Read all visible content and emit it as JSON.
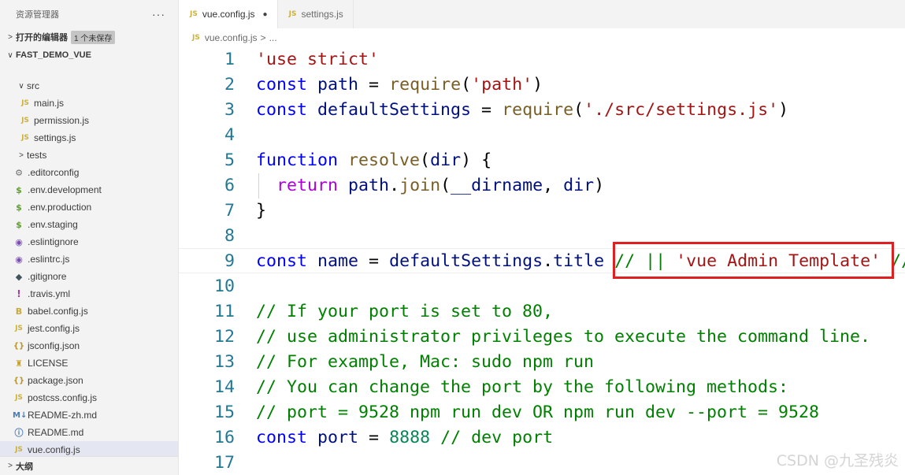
{
  "explorer": {
    "title": "资源管理器",
    "more": "···",
    "open_editors": {
      "label": "打开的编辑器",
      "badge": "1 个未保存"
    },
    "project": {
      "label": "FAST_DEMO_VUE"
    },
    "tree": [
      {
        "name": "src",
        "indent": 1,
        "type": "folder",
        "chev": "∨"
      },
      {
        "name": "main.js",
        "indent": 2,
        "icon": "JS"
      },
      {
        "name": "permission.js",
        "indent": 2,
        "icon": "JS"
      },
      {
        "name": "settings.js",
        "indent": 2,
        "icon": "JS"
      },
      {
        "name": "tests",
        "indent": 1,
        "type": "folder",
        "chev": ">"
      },
      {
        "name": ".editorconfig",
        "indent": 1,
        "icon": "⚙"
      },
      {
        "name": ".env.development",
        "indent": 1,
        "icon": "$"
      },
      {
        "name": ".env.production",
        "indent": 1,
        "icon": "$"
      },
      {
        "name": ".env.staging",
        "indent": 1,
        "icon": "$"
      },
      {
        "name": ".eslintignore",
        "indent": 1,
        "icon": "◉"
      },
      {
        "name": ".eslintrc.js",
        "indent": 1,
        "icon": "◉"
      },
      {
        "name": ".gitignore",
        "indent": 1,
        "icon": "◆"
      },
      {
        "name": ".travis.yml",
        "indent": 1,
        "icon": "!"
      },
      {
        "name": "babel.config.js",
        "indent": 1,
        "icon": "B"
      },
      {
        "name": "jest.config.js",
        "indent": 1,
        "icon": "JS"
      },
      {
        "name": "jsconfig.json",
        "indent": 1,
        "icon": "{}"
      },
      {
        "name": "LICENSE",
        "indent": 1,
        "icon": "♜"
      },
      {
        "name": "package.json",
        "indent": 1,
        "icon": "{}"
      },
      {
        "name": "postcss.config.js",
        "indent": 1,
        "icon": "JS"
      },
      {
        "name": "README-zh.md",
        "indent": 1,
        "icon": "M↓"
      },
      {
        "name": "README.md",
        "indent": 1,
        "icon": "ⓘ"
      },
      {
        "name": "vue.config.js",
        "indent": 1,
        "icon": "JS",
        "selected": true
      }
    ],
    "outline": {
      "label": "大纲"
    }
  },
  "tabs": [
    {
      "label": "vue.config.js",
      "icon": "JS",
      "active": true,
      "dirty": "●"
    },
    {
      "label": "settings.js",
      "icon": "JS",
      "active": false
    }
  ],
  "breadcrumb": {
    "icon": "JS",
    "file": "vue.config.js",
    "sep": ">",
    "rest": "..."
  },
  "editor": {
    "lines": [
      {
        "n": "1",
        "tokens": [
          [
            "str",
            "'use strict'"
          ]
        ]
      },
      {
        "n": "2",
        "tokens": [
          [
            "kw",
            "const"
          ],
          [
            "plain",
            " "
          ],
          [
            "var",
            "path"
          ],
          [
            "plain",
            " = "
          ],
          [
            "fn",
            "require"
          ],
          [
            "plain",
            "("
          ],
          [
            "str",
            "'path'"
          ],
          [
            "plain",
            ")"
          ]
        ]
      },
      {
        "n": "3",
        "tokens": [
          [
            "kw",
            "const"
          ],
          [
            "plain",
            " "
          ],
          [
            "var",
            "defaultSettings"
          ],
          [
            "plain",
            " = "
          ],
          [
            "fn",
            "require"
          ],
          [
            "plain",
            "("
          ],
          [
            "str",
            "'./src/settings.js'"
          ],
          [
            "plain",
            ")"
          ]
        ]
      },
      {
        "n": "4",
        "tokens": []
      },
      {
        "n": "5",
        "tokens": [
          [
            "kw",
            "function"
          ],
          [
            "plain",
            " "
          ],
          [
            "fn",
            "resolve"
          ],
          [
            "plain",
            "("
          ],
          [
            "var",
            "dir"
          ],
          [
            "plain",
            ") {"
          ]
        ]
      },
      {
        "n": "6",
        "tokens": [
          [
            "plain",
            "  "
          ],
          [
            "kw2",
            "return"
          ],
          [
            "plain",
            " "
          ],
          [
            "var",
            "path"
          ],
          [
            "plain",
            "."
          ],
          [
            "fn",
            "join"
          ],
          [
            "plain",
            "("
          ],
          [
            "var",
            "__dirname"
          ],
          [
            "plain",
            ", "
          ],
          [
            "var",
            "dir"
          ],
          [
            "plain",
            ")"
          ]
        ]
      },
      {
        "n": "7",
        "tokens": [
          [
            "plain",
            "}"
          ]
        ]
      },
      {
        "n": "8",
        "tokens": []
      },
      {
        "n": "9",
        "tokens": [
          [
            "kw",
            "const"
          ],
          [
            "plain",
            " "
          ],
          [
            "var",
            "name"
          ],
          [
            "plain",
            " = "
          ],
          [
            "var",
            "defaultSettings"
          ],
          [
            "plain",
            "."
          ],
          [
            "var",
            "title"
          ],
          [
            "plain",
            " "
          ],
          [
            "cm",
            "// || "
          ],
          [
            "str",
            "'vue Admin Template'"
          ],
          [
            "cm",
            " //"
          ]
        ]
      },
      {
        "n": "10",
        "tokens": []
      },
      {
        "n": "11",
        "tokens": [
          [
            "cm",
            "// If your port is set to 80,"
          ]
        ]
      },
      {
        "n": "12",
        "tokens": [
          [
            "cm",
            "// use administrator privileges to execute the command line."
          ]
        ]
      },
      {
        "n": "13",
        "tokens": [
          [
            "cm",
            "// For example, Mac: sudo npm run"
          ]
        ]
      },
      {
        "n": "14",
        "tokens": [
          [
            "cm",
            "// You can change the port by the following methods:"
          ]
        ]
      },
      {
        "n": "15",
        "tokens": [
          [
            "cm",
            "// port = 9528 npm run dev OR npm run dev --port = 9528"
          ]
        ]
      },
      {
        "n": "16",
        "tokens": [
          [
            "kw",
            "const"
          ],
          [
            "plain",
            " "
          ],
          [
            "var",
            "port"
          ],
          [
            "plain",
            " = "
          ],
          [
            "num",
            "8888"
          ],
          [
            "plain",
            " "
          ],
          [
            "cm",
            "// dev port"
          ]
        ]
      },
      {
        "n": "17",
        "tokens": []
      }
    ],
    "current_line": "9"
  },
  "watermark": "CSDN @九圣残炎",
  "colors": {
    "keyword": "#0000ff",
    "control": "#af00db",
    "string": "#a31515",
    "function": "#795e26",
    "variable": "#001080",
    "comment": "#008000",
    "number": "#098658",
    "line_number": "#237893",
    "highlight_box": "#e02020"
  }
}
